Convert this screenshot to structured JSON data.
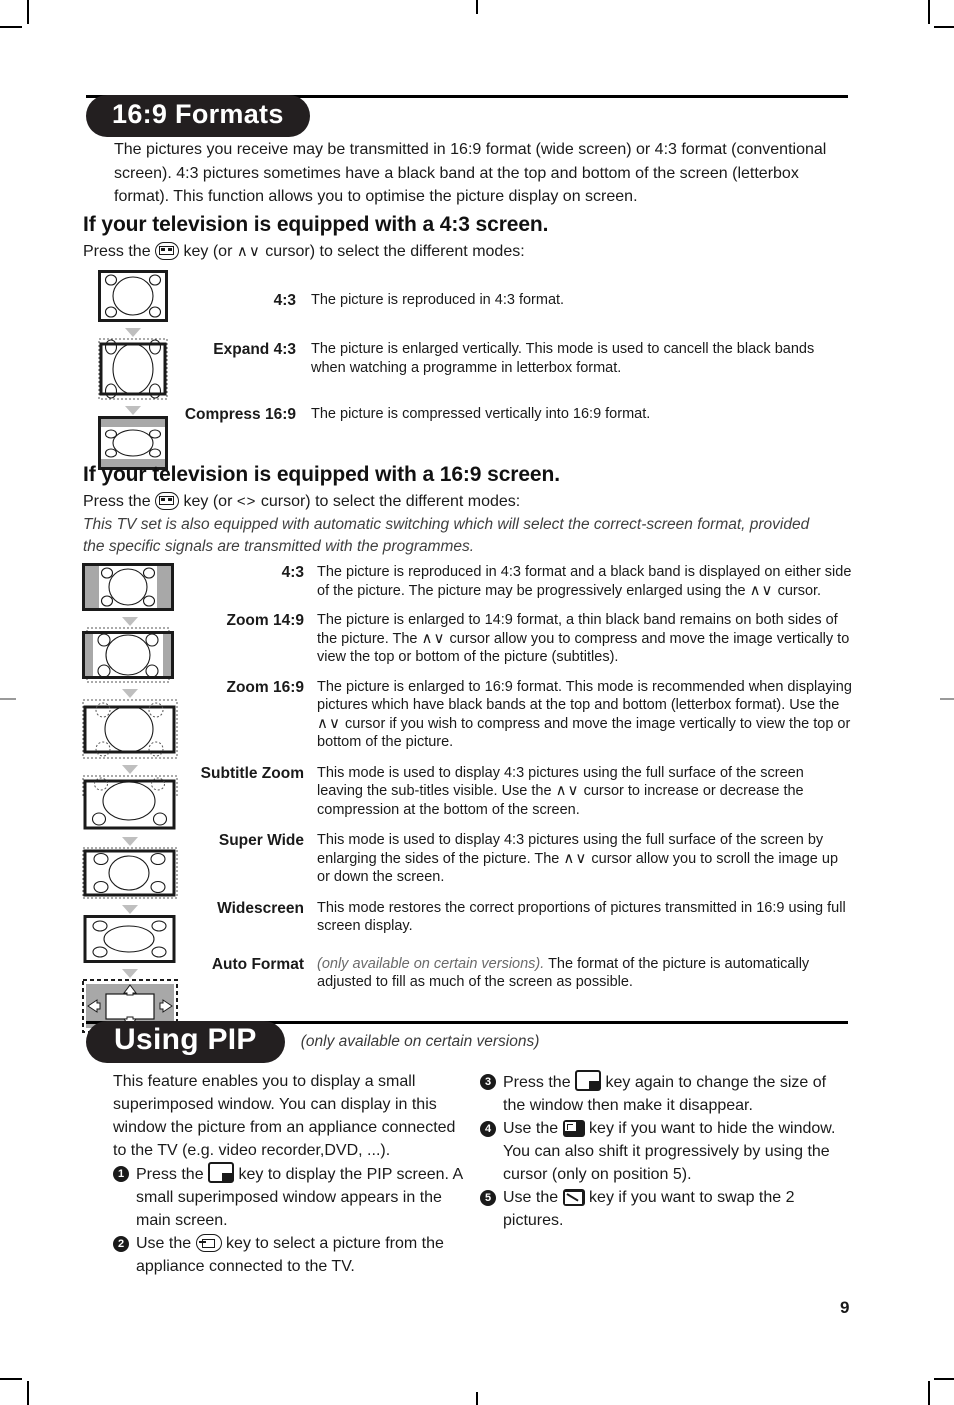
{
  "page_number": "9",
  "section1": {
    "banner": "16:9 Formats",
    "intro": "The pictures you receive may be transmitted in 16:9 format (wide screen) or 4:3 format (conventional screen). 4:3 pictures sometimes have a black band at the top and bottom of the screen (letterbox format). This function allows you to optimise the picture display on screen.",
    "sub43": {
      "heading": "If your television is equipped with a 4:3 screen.",
      "press_before": "Press the",
      "press_middle": "key (or",
      "cursor": "∧∨",
      "press_after": "cursor) to select the different modes:",
      "items": [
        {
          "label": "4:3",
          "desc": "The picture is reproduced in 4:3 format."
        },
        {
          "label": "Expand 4:3",
          "desc": "The picture is enlarged vertically. This mode is used to cancell the black bands when watching a programme in letterbox format."
        },
        {
          "label": "Compress 16:9",
          "desc": "The picture is compressed vertically into 16:9 format."
        }
      ]
    },
    "sub169": {
      "heading": "If your television is equipped with a 16:9 screen.",
      "press_before": "Press the",
      "press_middle": "key (or",
      "cursor": "<>",
      "press_after": "cursor) to select the different modes:",
      "note": "This TV set is also equipped with automatic switching which will select the correct-screen format, provided the specific signals are transmitted with the programmes.",
      "items": [
        {
          "label": "4:3",
          "desc_1": "The picture is reproduced in 4:3 format and a black band is displayed on either side of the picture. The picture may be progressively enlarged using the",
          "cursor": "∧∨",
          "desc_2": "cursor."
        },
        {
          "label": "Zoom 14:9",
          "desc_1": "The picture is enlarged to 14:9 format, a thin black band remains on both sides of the picture. The",
          "cursor": "∧∨",
          "desc_2": "cursor allow you to compress and move the image vertically to view the top or bottom of the picture (subtitles)."
        },
        {
          "label": "Zoom 16:9",
          "desc_1": "The picture is enlarged to 16:9 format. This mode is recommended when displaying pictures which have black bands at the top and bottom (letterbox format). Use the",
          "cursor": "∧∨",
          "desc_2": "cursor if you wish to compress and move the image vertically to view the top or bottom of the picture."
        },
        {
          "label": "Subtitle Zoom",
          "desc_1": "This mode is used to display 4:3 pictures using the full surface of the screen leaving the sub-titles visible. Use the",
          "cursor": "∧∨",
          "desc_2": "cursor to increase or decrease the compression at the bottom of the screen."
        },
        {
          "label": "Super Wide",
          "desc_1": "This mode is used to display 4:3 pictures using the full surface of the screen by enlarging the sides of the picture. The",
          "cursor": "∧∨",
          "desc_2": "cursor allow you to scroll the image up or down the screen."
        },
        {
          "label": "Widescreen",
          "desc_1": "This mode restores the correct proportions of pictures transmitted in 16:9 using full screen display.",
          "cursor": "",
          "desc_2": ""
        },
        {
          "label": "Auto Format",
          "note": "(only available on certain versions).",
          "desc_1": "The format of the picture is automatically adjusted to fill as much of the screen as possible.",
          "cursor": "",
          "desc_2": ""
        }
      ]
    }
  },
  "section2": {
    "banner": "Using PIP",
    "banner_note": "(only available on certain versions)",
    "left_intro": "This feature enables you to display a small superimposed window. You can display in this window the picture from an appliance connected to the TV (e.g. video recorder,DVD, ...).",
    "steps_left": [
      {
        "num": "1",
        "before": "Press the",
        "icon": "pip-key-icon",
        "after": "key to display the PIP screen. A small superimposed window appears in the main screen."
      },
      {
        "num": "2",
        "before": "Use the",
        "icon": "source-key-icon",
        "after": "key to select a picture from the appliance connected to the TV."
      }
    ],
    "steps_right": [
      {
        "num": "3",
        "before": "Press the",
        "icon": "pip-key-icon",
        "after": "key again to change the size of the window then make it disappear."
      },
      {
        "num": "4",
        "before": "Use the",
        "icon": "hide-window-key-icon",
        "after": "key if you want to hide the window. You can also shift it progressively by using the cursor (only on position 5)."
      },
      {
        "num": "5",
        "before": "Use the",
        "icon": "swap-pictures-key-icon",
        "after": "key if you want to swap the 2 pictures."
      }
    ]
  },
  "colors": {
    "banner_bg": "#231f20",
    "text": "#1a1a1a",
    "grey_band": "#a8a8a8",
    "arrow": "#bfbfbf"
  }
}
